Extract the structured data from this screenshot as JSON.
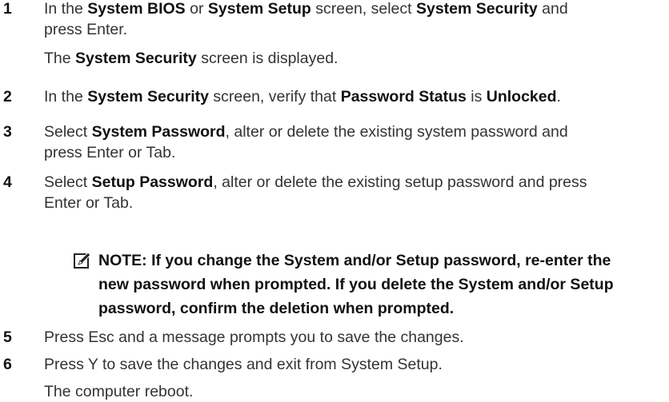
{
  "steps": [
    {
      "number": "1",
      "line1": {
        "t0": "In the ",
        "b0": "System BIOS",
        "t1": " or ",
        "b1": "System Setup",
        "t2": " screen, select ",
        "b2": "System Security",
        "t3": " and"
      },
      "line2": "press Enter.",
      "result": {
        "t0": "The ",
        "b0": "System Security",
        "t1": " screen is displayed."
      }
    },
    {
      "number": "2",
      "line1": {
        "t0": "In the ",
        "b0": "System Security",
        "t1": " screen, verify that ",
        "b1": "Password Status",
        "t2": " is ",
        "b2": "Unlocked",
        "t3": "."
      }
    },
    {
      "number": "3",
      "line1": {
        "t0": "Select ",
        "b0": "System Password",
        "t1": ", alter or delete the existing system password and"
      },
      "line2": "press Enter or Tab."
    },
    {
      "number": "4",
      "line1": {
        "t0": "Select ",
        "b0": "Setup Password",
        "t1": ", alter or delete the existing setup password and press"
      },
      "line2": "Enter or Tab."
    },
    {
      "number": "5",
      "text": "Press Esc and a message prompts you to save the changes."
    },
    {
      "number": "6",
      "text": "Press Y to save the changes and exit from System Setup.",
      "result": "The computer reboot."
    }
  ],
  "note": {
    "icon": "pencil-note-icon",
    "lines": [
      "NOTE: If you change the System and/or Setup password, re-enter the",
      "new password when prompted. If you delete the System and/or Setup",
      "password, confirm the deletion when prompted."
    ]
  },
  "colors": {
    "body_text": "#333333",
    "bold_text": "#111111",
    "background": "#ffffff"
  }
}
